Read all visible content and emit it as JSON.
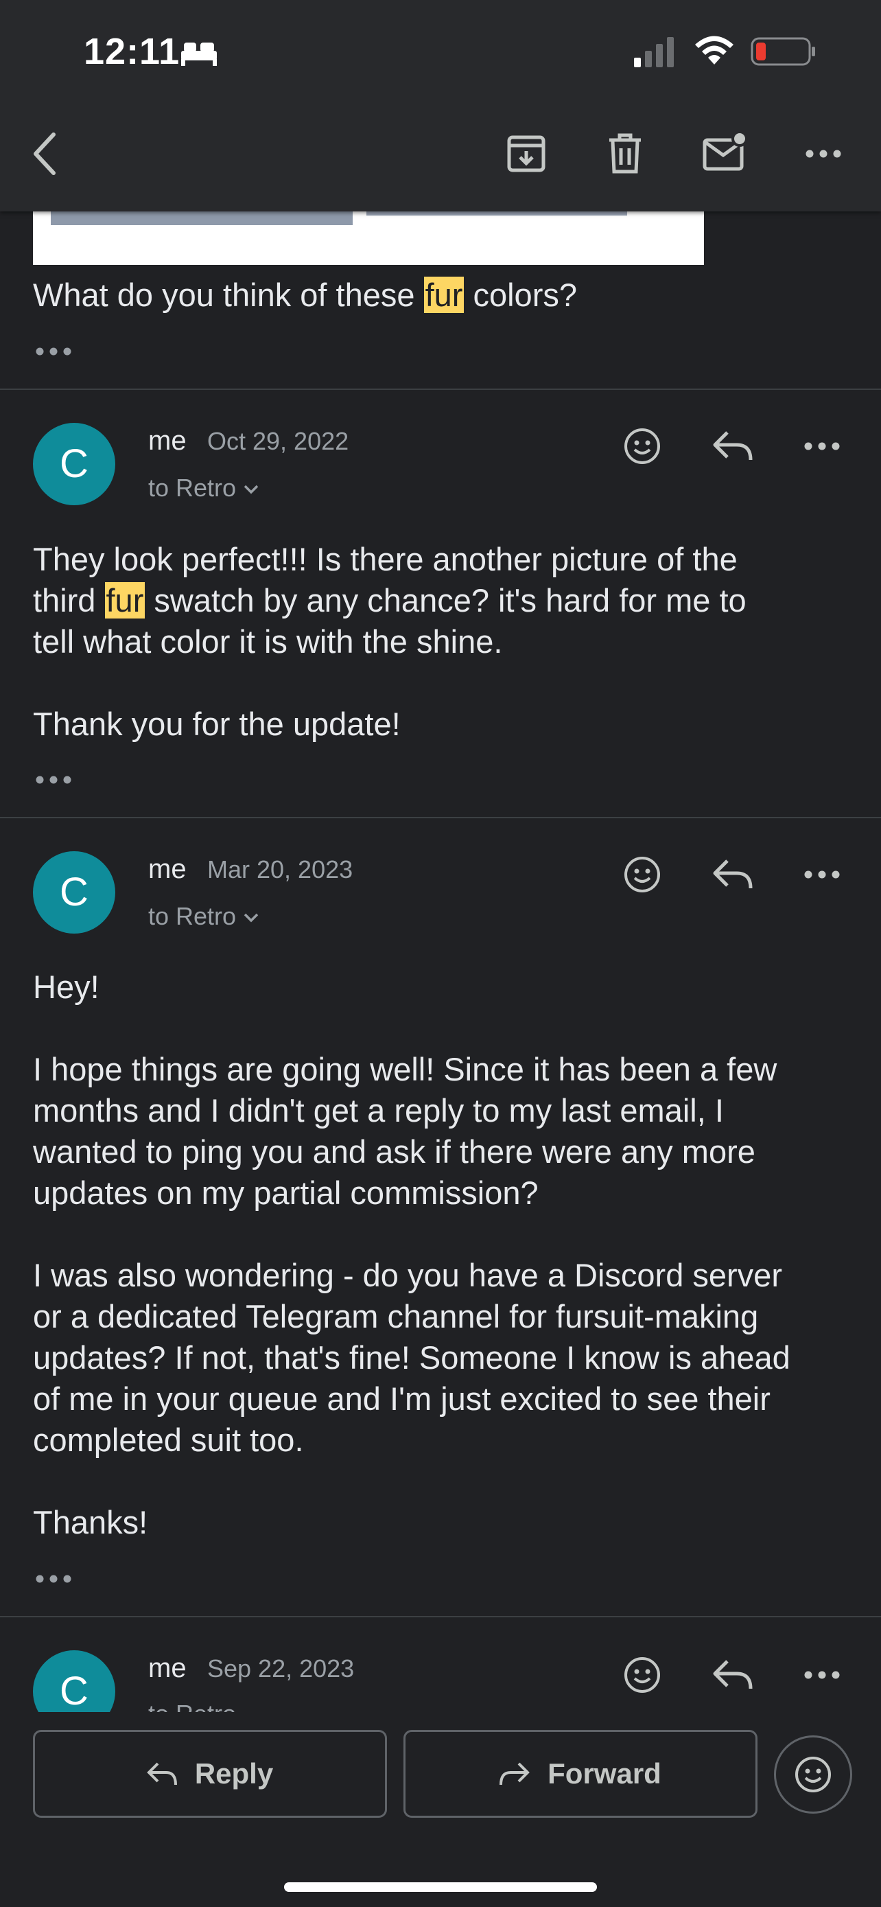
{
  "status_bar": {
    "time": "12:11"
  },
  "toolbar": {
    "icons": [
      "back-arrow-icon",
      "archive-icon",
      "delete-icon",
      "mark-unread-icon",
      "more-icon"
    ]
  },
  "previous_message": {
    "text_before": "What do you think of these ",
    "highlight": "fur",
    "text_after": " colors?"
  },
  "messages": [
    {
      "avatar": "C",
      "sender": "me",
      "date": "Oct 29, 2022",
      "to": "to Retro",
      "body_1": "They look perfect!!! Is there another picture of the\nthird ",
      "highlight": "fur",
      "body_2": " swatch by any chance? it's hard for me to\ntell what color it is with the shine.\n\nThank you for the update!"
    },
    {
      "avatar": "C",
      "sender": "me",
      "date": "Mar 20, 2023",
      "to": "to Retro",
      "body": "Hey!\n\nI hope things are going well! Since it has been a few\nmonths and I didn't get a reply to my last email, I\nwanted to ping you and ask if there were any more\nupdates on my partial commission?\n\nI was also wondering - do you have a Discord server\nor a dedicated Telegram channel for fursuit-making\nupdates? If not, that's fine! Someone I know is ahead\nof me in your queue and I'm just excited to see their\ncompleted suit too.\n\nThanks!"
    },
    {
      "avatar": "C",
      "sender": "me",
      "date": "Sep 22, 2023",
      "to": "to Retro"
    }
  ],
  "bottom_actions": {
    "reply_label": "Reply",
    "forward_label": "Forward"
  }
}
